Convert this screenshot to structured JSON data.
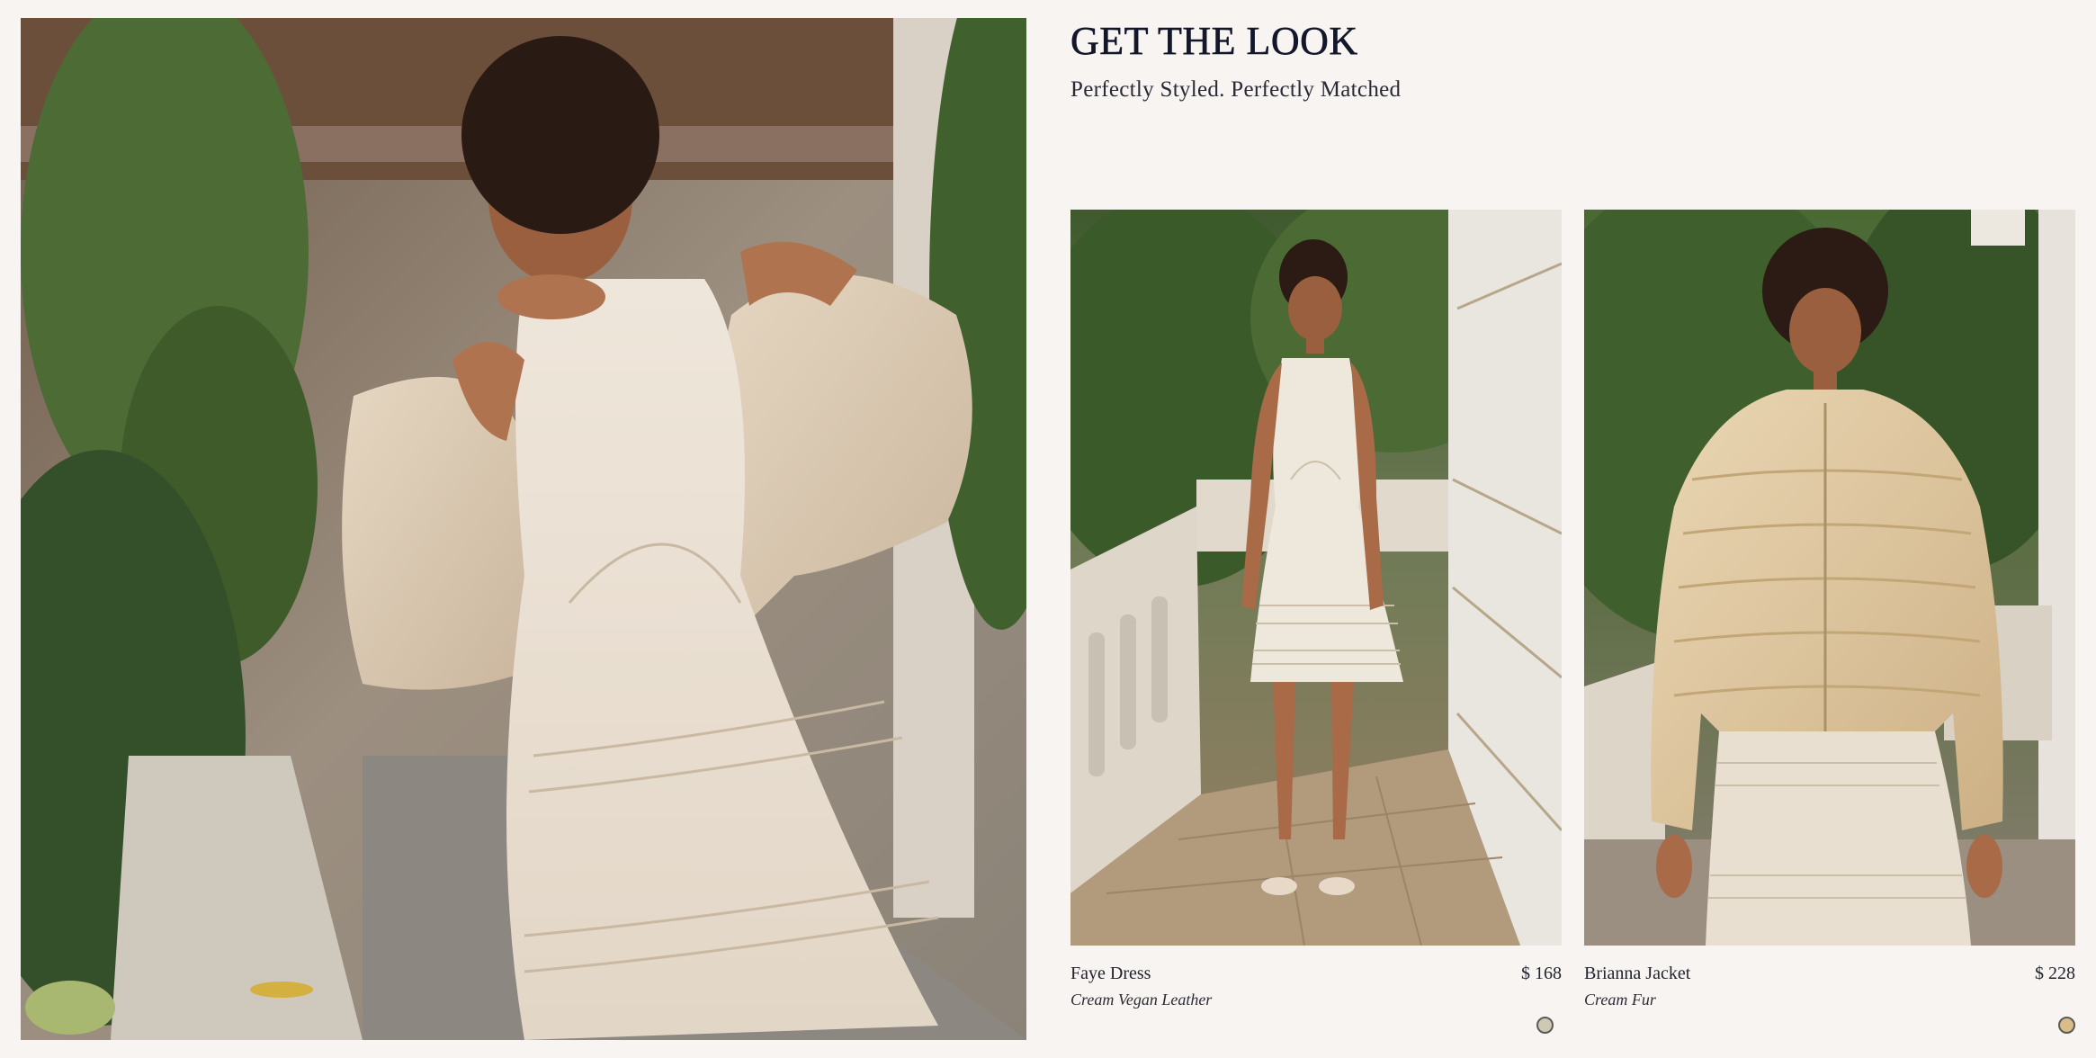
{
  "hero": {
    "image_alt": "Model in cream leather dress slipping off a faux fur jacket"
  },
  "look": {
    "title": "GET THE LOOK",
    "subtitle": "Perfectly Styled. Perfectly Matched"
  },
  "products": [
    {
      "name": "Faye Dress",
      "price": "$ 168",
      "material": "Cream Vegan Leather",
      "swatch_color": "#cfc9b4"
    },
    {
      "name": "Brianna Jacket",
      "price": "$ 228",
      "material": "Cream Fur",
      "swatch_color": "#d8bd88"
    }
  ],
  "colors": {
    "background": "#f7f4f2",
    "heading": "#12172a"
  }
}
